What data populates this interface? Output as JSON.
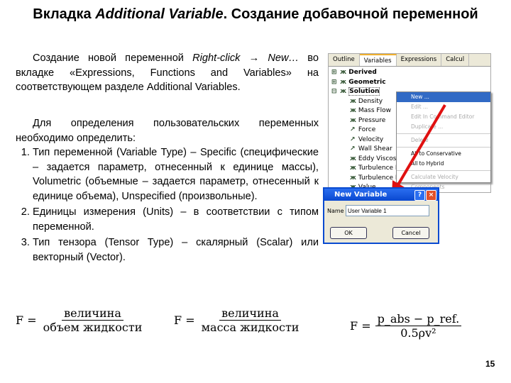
{
  "title": {
    "main": "Вкладка ",
    "italic": "Additional Variable",
    "rest": ". Создание добавочной переменной"
  },
  "intro": {
    "a": "Создание новой переменной ",
    "b": "Right-click → New…",
    "c": " во вкладке «Expressions, Functions and Variables» на соответствующем разделе Additional Variables."
  },
  "para2": "Для определения пользовательских переменных необходимо определить:",
  "list": [
    "Тип переменной (Variable Type) – Specific (специфические – задается параметр, отнесенный к единице массы), Volumetric (объемные – задается параметр, отнесенный к единице объема), Unspecified (произвольные).",
    "Единицы измерения (Units) – в соответствии с типом переменной.",
    "Тип тензора (Tensor Type) – скалярный (Scalar) или векторный (Vector)."
  ],
  "formulas": [
    {
      "lhs": "F =",
      "num": "величина",
      "den": "объем жидкости"
    },
    {
      "lhs": "F =",
      "num": "величина",
      "den": "масса жидкости"
    },
    {
      "lhs": "F =",
      "num": "p_abs − p_ref.",
      "den": "0.5ρv²"
    }
  ],
  "page_number": "15",
  "panel": {
    "tabs": [
      "Outline",
      "Variables",
      "Expressions",
      "Calcul"
    ],
    "groups": [
      "Derived",
      "Geometric",
      "Solution"
    ],
    "items": [
      "Density",
      "Mass Flow",
      "Pressure",
      "Force",
      "Velocity",
      "Wall Shear",
      "Eddy Viscosi",
      "Turbulence E",
      "Turbulence K",
      "Value"
    ]
  },
  "menu": {
    "items": [
      "New ...",
      "Edit ...",
      "Edit In Command Editor",
      "Duplicate ...",
      "Delete",
      "All to Conservative",
      "All to Hybrid",
      "Calculate Velocity Components"
    ]
  },
  "dialog": {
    "title": "New Variable",
    "name_label": "Name",
    "name_value": "User Variable 1",
    "ok": "OK",
    "cancel": "Cancel",
    "help": "?",
    "close": "×"
  },
  "colors": {
    "arrow": "#e01010",
    "selection": "#316ac5",
    "dialog_title": "#0a48d0"
  }
}
